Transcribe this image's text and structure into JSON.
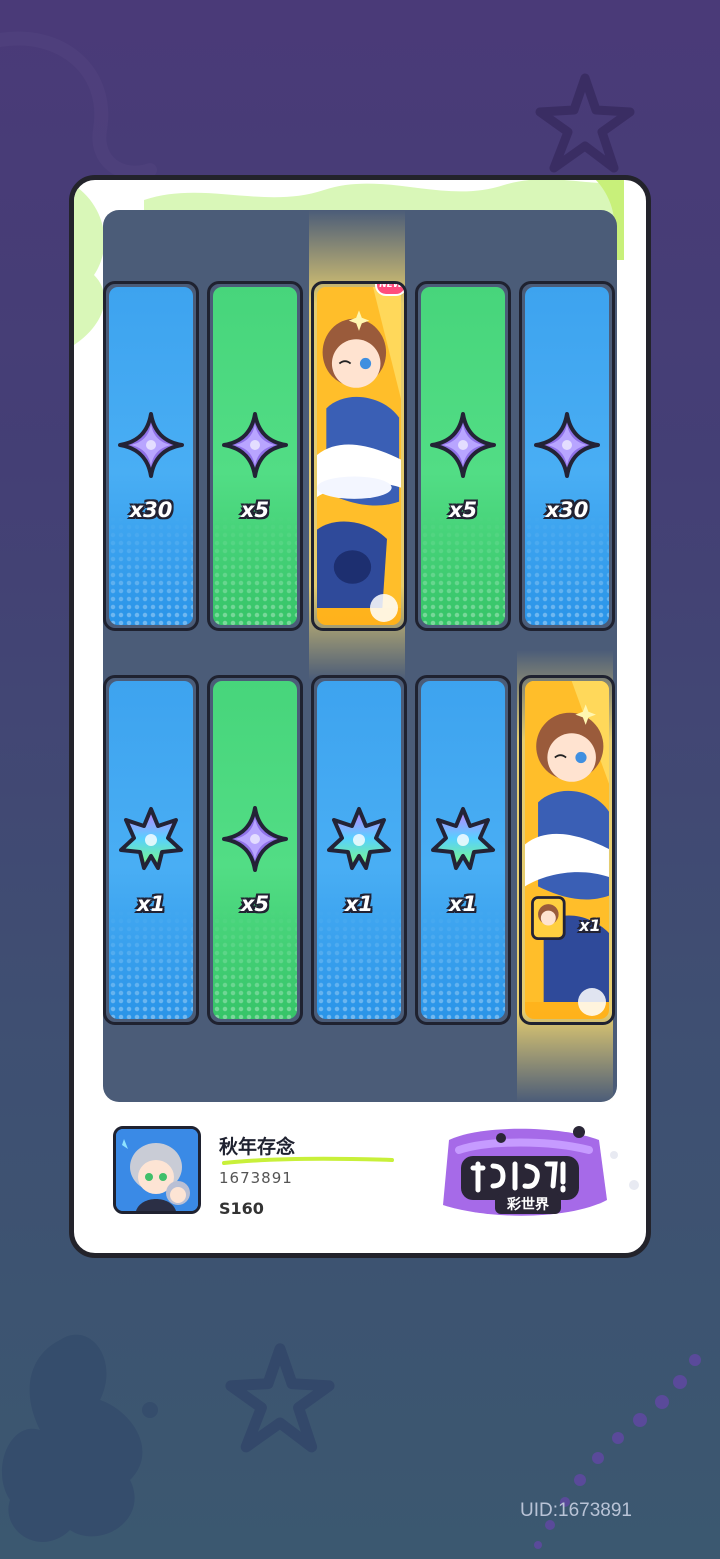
{
  "colors": {
    "tile_blue": "#3da3ef",
    "tile_green": "#47d57b",
    "highlight": "#ffd24a",
    "panel": "#4b5c78"
  },
  "rows": [
    {
      "tiles": [
        {
          "kind": "item",
          "color": "blue",
          "icon": "purple-star-crystal-icon",
          "qty": "x30"
        },
        {
          "kind": "item",
          "color": "green",
          "icon": "purple-star-crystal-icon",
          "qty": "x5"
        },
        {
          "kind": "character",
          "color": "gold",
          "badge": "NEW",
          "icon": "character-card-art"
        },
        {
          "kind": "item",
          "color": "green",
          "icon": "purple-star-crystal-icon",
          "qty": "x5"
        },
        {
          "kind": "item",
          "color": "blue",
          "icon": "purple-star-crystal-icon",
          "qty": "x30"
        }
      ]
    },
    {
      "tiles": [
        {
          "kind": "item",
          "color": "blue",
          "icon": "rainbow-leaf-crystal-icon",
          "qty": "x1"
        },
        {
          "kind": "item",
          "color": "green",
          "icon": "purple-star-crystal-icon",
          "qty": "x5"
        },
        {
          "kind": "item",
          "color": "blue",
          "icon": "rainbow-leaf-crystal-icon",
          "qty": "x1"
        },
        {
          "kind": "item",
          "color": "blue",
          "icon": "rainbow-leaf-crystal-icon",
          "qty": "x1"
        },
        {
          "kind": "character",
          "color": "gold",
          "icon": "character-card-art",
          "qty": "x1"
        }
      ]
    }
  ],
  "player": {
    "name": "秋年存念",
    "id": "1673891",
    "server": "S160"
  },
  "logo": {
    "subtitle": "彩世界"
  },
  "uid_label": "UID:1673891"
}
